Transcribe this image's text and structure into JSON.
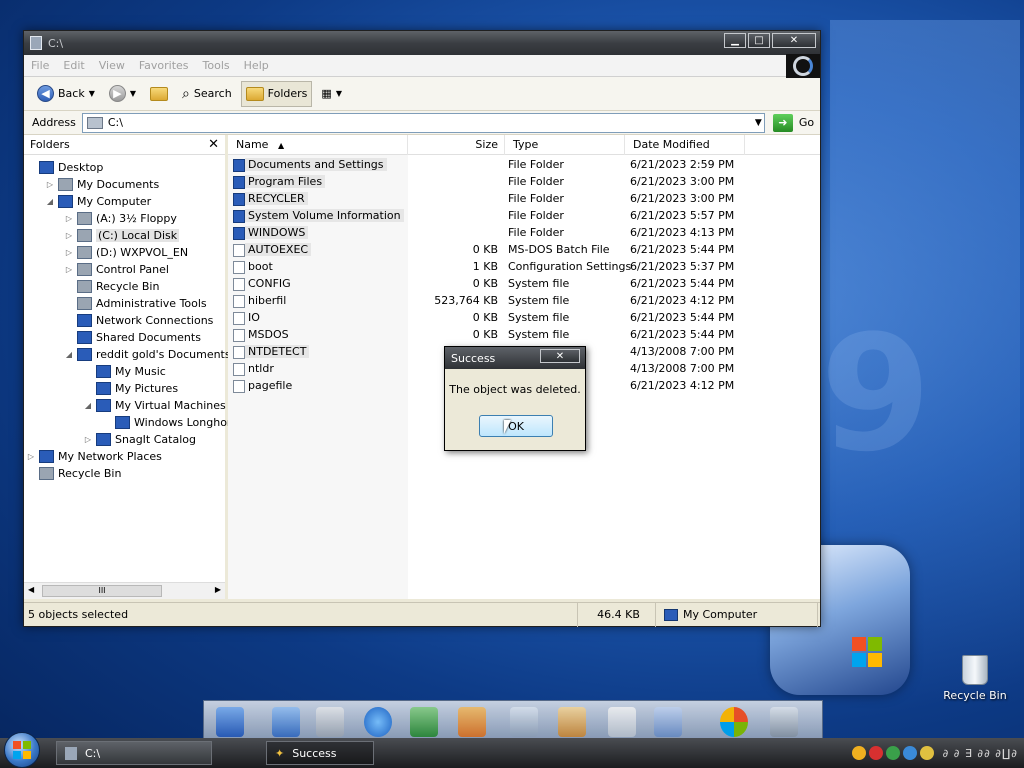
{
  "window": {
    "title": "C:\\",
    "menu": [
      "File",
      "Edit",
      "View",
      "Favorites",
      "Tools",
      "Help"
    ],
    "toolbar": {
      "back": "Back",
      "search": "Search",
      "folders": "Folders"
    },
    "address": {
      "label": "Address",
      "value": "C:\\",
      "go": "Go"
    }
  },
  "folders_pane": {
    "title": "Folders",
    "close": "✕",
    "tree": [
      {
        "label": "Desktop",
        "depth": 0,
        "icon": "desktop-icon",
        "expander": ""
      },
      {
        "label": "My Documents",
        "depth": 1,
        "icon": "documents-icon",
        "expander": "▷"
      },
      {
        "label": "My Computer",
        "depth": 1,
        "icon": "computer-icon",
        "expander": "◢"
      },
      {
        "label": "(A:) 3½ Floppy",
        "depth": 2,
        "icon": "floppy-icon",
        "expander": "▷"
      },
      {
        "label": "(C:) Local Disk",
        "depth": 2,
        "icon": "disk-icon",
        "expander": "▷",
        "selected": true
      },
      {
        "label": "(D:) WXPVOL_EN",
        "depth": 2,
        "icon": "cd-icon",
        "expander": "▷"
      },
      {
        "label": "Control Panel",
        "depth": 2,
        "icon": "control-panel-icon",
        "expander": "▷"
      },
      {
        "label": "Recycle Bin",
        "depth": 2,
        "icon": "recycle-bin-icon",
        "expander": ""
      },
      {
        "label": "Administrative Tools",
        "depth": 2,
        "icon": "admin-tools-icon",
        "expander": ""
      },
      {
        "label": "Network Connections",
        "depth": 2,
        "icon": "network-icon",
        "expander": ""
      },
      {
        "label": "Shared Documents",
        "depth": 2,
        "icon": "folder-icon",
        "expander": ""
      },
      {
        "label": "reddit gold's Documents",
        "depth": 2,
        "icon": "folder-icon",
        "expander": "◢"
      },
      {
        "label": "My Music",
        "depth": 3,
        "icon": "music-folder-icon",
        "expander": ""
      },
      {
        "label": "My Pictures",
        "depth": 3,
        "icon": "pictures-folder-icon",
        "expander": ""
      },
      {
        "label": "My Virtual Machines",
        "depth": 3,
        "icon": "folder-icon",
        "expander": "◢"
      },
      {
        "label": "Windows Longhorn (",
        "depth": 4,
        "icon": "folder-icon",
        "expander": ""
      },
      {
        "label": "SnagIt Catalog",
        "depth": 3,
        "icon": "folder-icon",
        "expander": "▷"
      },
      {
        "label": "My Network Places",
        "depth": 0,
        "icon": "network-places-icon",
        "expander": "▷"
      },
      {
        "label": "Recycle Bin",
        "depth": 0,
        "icon": "recycle-bin-icon",
        "expander": ""
      }
    ],
    "scroll_thumb": "III"
  },
  "file_list": {
    "columns": [
      "Name",
      "Size",
      "Type",
      "Date Modified"
    ],
    "sort_indicator": "▲",
    "rows": [
      {
        "name": "Documents and Settings",
        "size": "",
        "type": "File Folder",
        "date": "6/21/2023 2:59 PM",
        "folder": true,
        "selected": true
      },
      {
        "name": "Program Files",
        "size": "",
        "type": "File Folder",
        "date": "6/21/2023 3:00 PM",
        "folder": true,
        "selected": true
      },
      {
        "name": "RECYCLER",
        "size": "",
        "type": "File Folder",
        "date": "6/21/2023 3:00 PM",
        "folder": true,
        "selected": true
      },
      {
        "name": "System Volume Information",
        "size": "",
        "type": "File Folder",
        "date": "6/21/2023 5:57 PM",
        "folder": true,
        "selected": true
      },
      {
        "name": "WINDOWS",
        "size": "",
        "type": "File Folder",
        "date": "6/21/2023 4:13 PM",
        "folder": true,
        "selected": true
      },
      {
        "name": "AUTOEXEC",
        "size": "0 KB",
        "type": "MS-DOS Batch File",
        "date": "6/21/2023 5:44 PM",
        "folder": false,
        "selected": true
      },
      {
        "name": "boot",
        "size": "1 KB",
        "type": "Configuration Settings",
        "date": "6/21/2023 5:37 PM",
        "folder": false
      },
      {
        "name": "CONFIG",
        "size": "0 KB",
        "type": "System file",
        "date": "6/21/2023 5:44 PM",
        "folder": false
      },
      {
        "name": "hiberfil",
        "size": "523,764 KB",
        "type": "System file",
        "date": "6/21/2023 4:12 PM",
        "folder": false
      },
      {
        "name": "IO",
        "size": "0 KB",
        "type": "System file",
        "date": "6/21/2023 5:44 PM",
        "folder": false
      },
      {
        "name": "MSDOS",
        "size": "0 KB",
        "type": "System file",
        "date": "6/21/2023 5:44 PM",
        "folder": false
      },
      {
        "name": "NTDETECT",
        "size": "",
        "type": "ation",
        "date": "4/13/2008 7:00 PM",
        "folder": false,
        "selected": true
      },
      {
        "name": "ntldr",
        "size": "",
        "type": "",
        "date": "4/13/2008 7:00 PM",
        "folder": false
      },
      {
        "name": "pagefile",
        "size": "",
        "type": "",
        "date": "6/21/2023 4:12 PM",
        "folder": false
      }
    ]
  },
  "status": {
    "selection": "5 objects selected",
    "size": "46.4 KB",
    "location": "My Computer"
  },
  "dialog": {
    "title": "Success",
    "message": "The object was deleted.",
    "ok": "OK",
    "close": "✕"
  },
  "taskbar": {
    "items": [
      "C:\\",
      "Success"
    ],
    "clock": "∂ ∂ ∃ ∂∂ ∂∐∂"
  },
  "desktop": {
    "icons": [
      "Recycle Bin"
    ],
    "watermark": "9"
  }
}
